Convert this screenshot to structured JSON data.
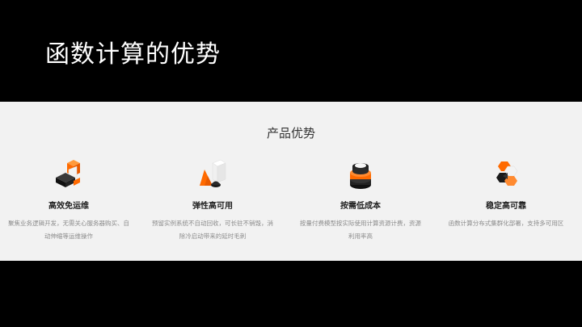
{
  "slide": {
    "title": "函数计算的优势"
  },
  "section": {
    "title": "产品优势"
  },
  "features": [
    {
      "title": "高效免运维",
      "desc": "聚焦业务逻辑开发，无需关心服务器购买、自动伸缩等运维操作",
      "icon": "blocks-icon"
    },
    {
      "title": "弹性高可用",
      "desc": "预留实例系统不自动回收，可长驻不销毁，消除冷启动带来的延时毛刺",
      "icon": "cone-cube-icon"
    },
    {
      "title": "按需低成本",
      "desc": "按量付费模型按实际使用计算资源计费，资源利用率高",
      "icon": "stacked-cylinder-icon"
    },
    {
      "title": "稳定高可靠",
      "desc": "函数计算分布式集群化部署，支持多可用区",
      "icon": "hexagon-cluster-icon"
    }
  ],
  "colors": {
    "accent": "#ff6a00",
    "dark": "#222222",
    "panel": "#f2f2f2"
  }
}
